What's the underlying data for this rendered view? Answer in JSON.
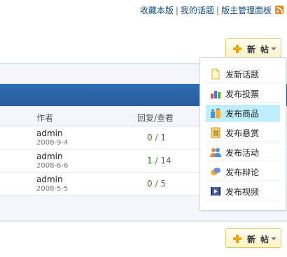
{
  "top_links": {
    "favorites": "收藏本版",
    "sep1": "|",
    "my_topics": "我的话题",
    "sep2": "|",
    "moderator_panel": "版主管理面板"
  },
  "new_post_button": {
    "label": "新帖"
  },
  "table": {
    "headers": {
      "author": "作者",
      "replies_views": "回复/查看"
    },
    "rows": [
      {
        "author": "admin",
        "date": "2008-9-4",
        "replies": "0",
        "views": "1"
      },
      {
        "author": "admin",
        "date": "2008-6-6",
        "replies": "1",
        "views": "14"
      },
      {
        "author": "admin",
        "date": "2008-5-5",
        "replies": "0",
        "views": "5"
      }
    ]
  },
  "new_post_menu": {
    "items": [
      {
        "label": "发新话题",
        "icon": "new-topic-icon"
      },
      {
        "label": "发布投票",
        "icon": "poll-icon"
      },
      {
        "label": "发布商品",
        "icon": "goods-icon",
        "active": true
      },
      {
        "label": "发布悬赏",
        "icon": "reward-icon"
      },
      {
        "label": "发布活动",
        "icon": "activity-icon"
      },
      {
        "label": "发布辩论",
        "icon": "debate-icon"
      },
      {
        "label": "发布视频",
        "icon": "video-icon"
      }
    ]
  },
  "colors": {
    "link": "#0f4f86",
    "header_bar": "#2e6cb1",
    "highlight": "#bfeeff",
    "button_border": "#e2c66b",
    "reply_count": "#1a8a00"
  }
}
